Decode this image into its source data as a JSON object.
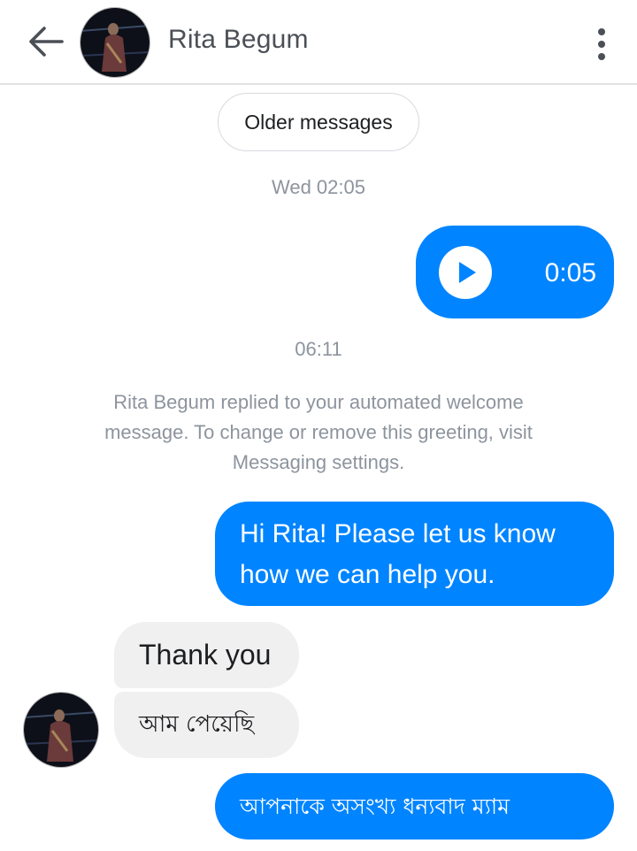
{
  "header": {
    "contact_name": "Rita Begum",
    "back_icon": "arrow-left-icon",
    "more_icon": "more-vertical-icon"
  },
  "conversation": {
    "older_messages_label": "Older messages",
    "timestamp_1": "Wed 02:05",
    "voice_message": {
      "duration": "0:05",
      "icon": "play-icon"
    },
    "timestamp_2": "06:11",
    "system_note": "Rita Begum replied to your automated welcome message. To change or remove this greeting, visit Messaging settings.",
    "messages": [
      {
        "direction": "outgoing",
        "text": "Hi Rita! Please let us know how we can help you."
      },
      {
        "direction": "incoming",
        "text": "Thank you"
      },
      {
        "direction": "incoming",
        "text": "আম পেয়েছি"
      },
      {
        "direction": "outgoing",
        "text": "আপনাকে অসংখ্য ধন্যবাদ ম্যাম"
      }
    ]
  },
  "colors": {
    "accent": "#0084ff",
    "incoming_bubble": "#f1f0f0",
    "meta_text": "#8d949e"
  }
}
